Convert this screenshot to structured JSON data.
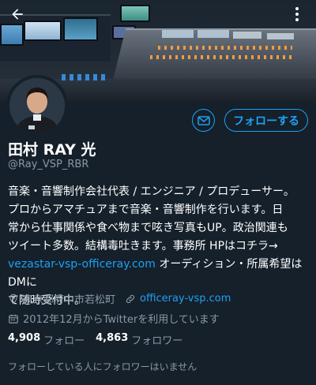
{
  "header": {
    "back_icon": "arrow-left-icon",
    "more_icon": "vertical-ellipsis-icon"
  },
  "profile": {
    "display_name": "田村 RAY 光",
    "handle": "@Ray_VSP_RBR",
    "follow_label": "フォローする",
    "message_icon": "mail-icon"
  },
  "bio": {
    "line1": "音楽・音響制作会社代表 / エンジニア / プロデューサー。",
    "line2": "プロからアマチュアまで音楽・音響制作を行います。日",
    "line3": "常から仕事関係や食べ物まで呟き写真もUP。政治関連も",
    "line4": "ツイート多数。結構毒吐きます。事務所 HPはコチラ→",
    "link_text": "vezastar-vsp-officeray.com",
    "line5_rest": " オーディション・所属希望はDMに",
    "line6": "て随時受付中。"
  },
  "meta": {
    "location": "東京都府中市若松町",
    "website": "officeray-vsp.com",
    "joined": "2012年12月からTwitterを利用しています"
  },
  "stats": {
    "following_count": "4,908",
    "following_label": "フォロー",
    "followers_count": "4,863",
    "followers_label": "フォロワー"
  },
  "note": "フォローしている人にフォロワーはいません",
  "colors": {
    "background": "#15202b",
    "accent": "#1da1f2",
    "secondary_text": "#8899a6"
  }
}
